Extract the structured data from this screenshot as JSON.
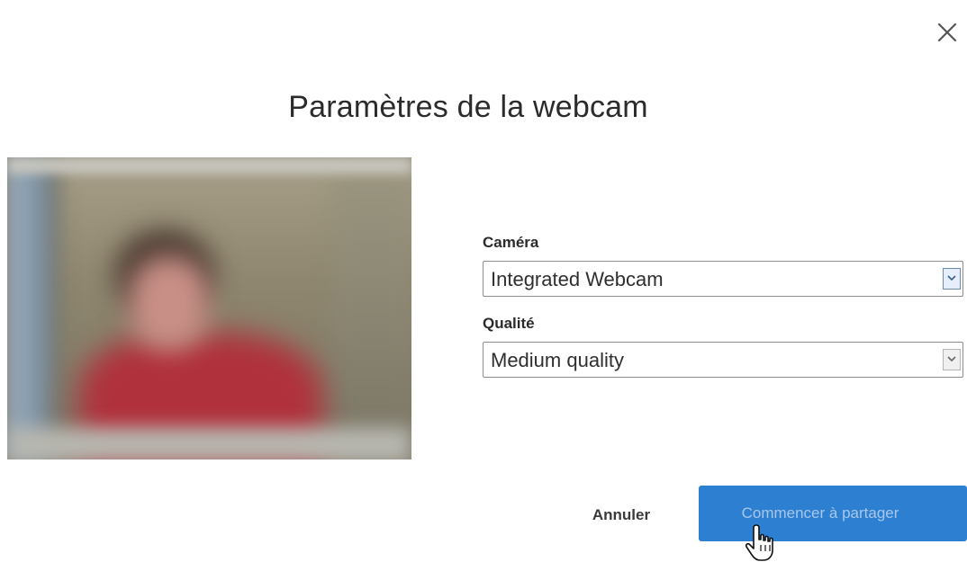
{
  "dialog": {
    "title": "Paramètres de la webcam",
    "close_icon": "close-icon"
  },
  "preview": {
    "description_icon": "webcam-preview"
  },
  "form": {
    "camera_label": "Caméra",
    "camera_value": "Integrated Webcam",
    "quality_label": "Qualité",
    "quality_value": "Medium quality"
  },
  "actions": {
    "cancel_label": "Annuler",
    "start_label": "Commencer à partager"
  },
  "colors": {
    "primary": "#2d7fd1",
    "primary_text": "#a8c7ea",
    "text": "#2b2b2b"
  }
}
